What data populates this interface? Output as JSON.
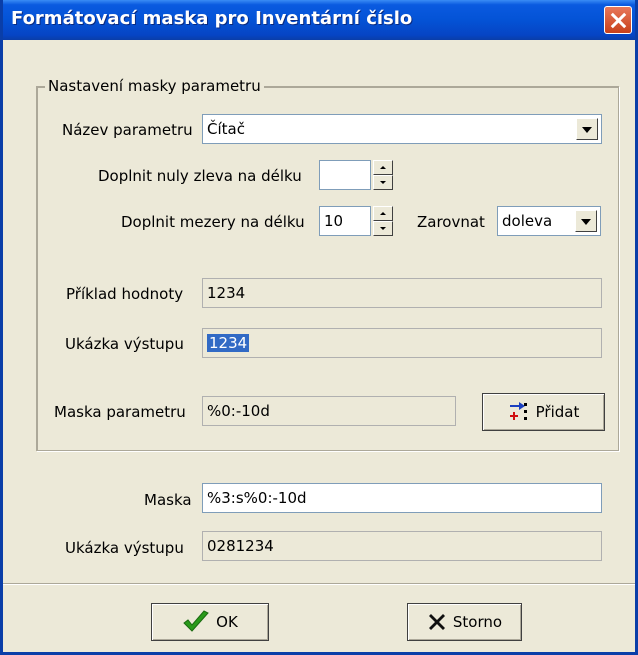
{
  "window": {
    "title": "Formátovací maska pro Inventární číslo"
  },
  "group": {
    "legend": "Nastavení masky parametru"
  },
  "param_name": {
    "label": "Název parametru",
    "value": "Čítač"
  },
  "pad_zeros": {
    "label": "Doplnit nuly zleva na délku",
    "value": ""
  },
  "pad_spaces": {
    "label": "Doplnit mezery na délku",
    "value": "10"
  },
  "align": {
    "label": "Zarovnat",
    "value": "doleva"
  },
  "example_value": {
    "label": "Příklad hodnoty",
    "value": "1234"
  },
  "output_preview": {
    "label": "Ukázka výstupu",
    "value": "1234"
  },
  "param_mask": {
    "label": "Maska parametru",
    "value": "%0:-10d"
  },
  "add_button": {
    "label": "Přidat"
  },
  "mask": {
    "label": "Maska",
    "value": "%3:s%0:-10d"
  },
  "final_output": {
    "label": "Ukázka výstupu",
    "value": "0281234"
  },
  "buttons": {
    "ok": "OK",
    "cancel": "Storno"
  },
  "colors": {
    "titlebar": "#0453d6",
    "selection": "#316ac5",
    "dialog_bg": "#ece9d8"
  }
}
